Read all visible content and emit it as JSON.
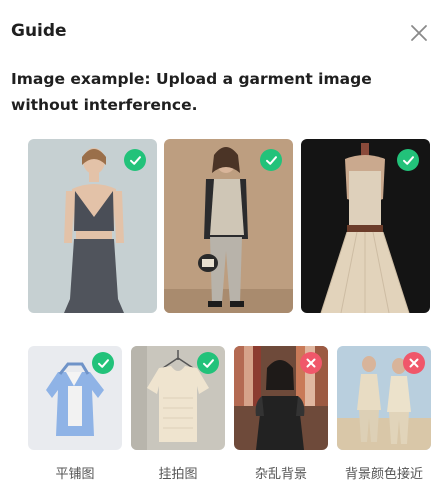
{
  "dialog": {
    "title": "Guide",
    "close_icon": "close-icon",
    "description": "Image example: Upload a garment image without interference."
  },
  "good_examples": [
    {
      "name": "model-crop-top-skirt",
      "status": "correct"
    },
    {
      "name": "model-blazer-trousers",
      "status": "correct"
    },
    {
      "name": "mannequin-dress",
      "status": "correct"
    }
  ],
  "type_examples": [
    {
      "label": "平铺图",
      "status": "correct"
    },
    {
      "label": "挂拍图",
      "status": "correct"
    },
    {
      "label": "杂乱背景",
      "status": "incorrect"
    },
    {
      "label": "背景颜色接近",
      "status": "incorrect"
    }
  ],
  "colors": {
    "correct": "#22c27a",
    "incorrect": "#f0576a"
  }
}
